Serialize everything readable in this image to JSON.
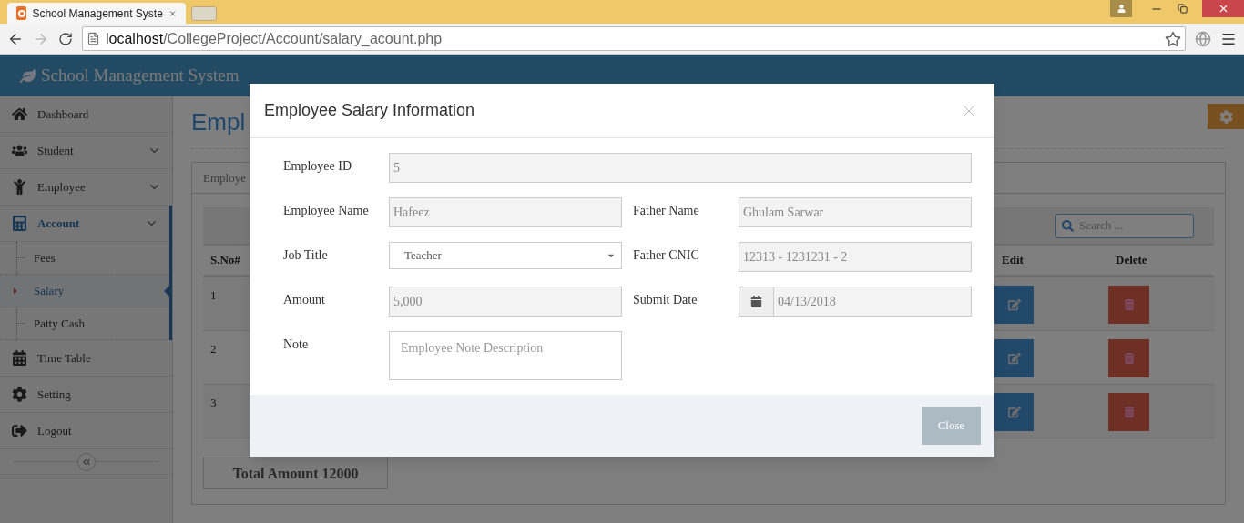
{
  "browser": {
    "tab_title": "School Management Syste",
    "url_host": "localhost",
    "url_path": "/CollegeProject/Account/salary_acount.php"
  },
  "app": {
    "brand": "School Management System"
  },
  "sidebar": {
    "items": [
      {
        "label": "Dashboard",
        "selected": false,
        "kind": "link"
      },
      {
        "label": "Student",
        "selected": false,
        "kind": "group"
      },
      {
        "label": "Employee",
        "selected": false,
        "kind": "group"
      },
      {
        "label": "Account",
        "selected": true,
        "kind": "group",
        "expanded": true,
        "children": [
          {
            "label": "Fees",
            "selected": false
          },
          {
            "label": "Salary",
            "selected": true
          },
          {
            "label": "Patty Cash",
            "selected": false
          }
        ]
      },
      {
        "label": "Time Table",
        "selected": false,
        "kind": "link"
      },
      {
        "label": "Setting",
        "selected": false,
        "kind": "link"
      },
      {
        "label": "Logout",
        "selected": false,
        "kind": "link"
      }
    ]
  },
  "page": {
    "title": "Empl",
    "tab": "Employe"
  },
  "table": {
    "search_placeholder": "Search ...",
    "columns": [
      "S.No#",
      "Edit",
      "Delete"
    ],
    "rows": [
      {
        "sno": "1"
      },
      {
        "sno": "2"
      },
      {
        "sno": "3"
      }
    ],
    "total": "Total Amount 12000"
  },
  "modal": {
    "title": "Employee Salary Information",
    "close_label": "Close",
    "rows": [
      [
        {
          "kind": "text",
          "label": "Employee ID",
          "value": "5",
          "wide": true
        }
      ],
      [
        {
          "kind": "text",
          "label": "Employee Name",
          "value": "Hafeez"
        },
        {
          "kind": "text",
          "label": "Father Name",
          "value": "Ghulam Sarwar"
        }
      ],
      [
        {
          "kind": "select",
          "label": "Job Title",
          "value": "Teacher"
        },
        {
          "kind": "text",
          "label": "Father CNIC",
          "value": "12313 - 1231231 - 2"
        }
      ],
      [
        {
          "kind": "text",
          "label": "Amount",
          "value": "5,000"
        },
        {
          "kind": "date",
          "label": "Submit Date",
          "value": "04/13/2018"
        }
      ],
      [
        {
          "kind": "textarea",
          "label": "Note",
          "placeholder": "Employee Note Description"
        }
      ]
    ]
  }
}
